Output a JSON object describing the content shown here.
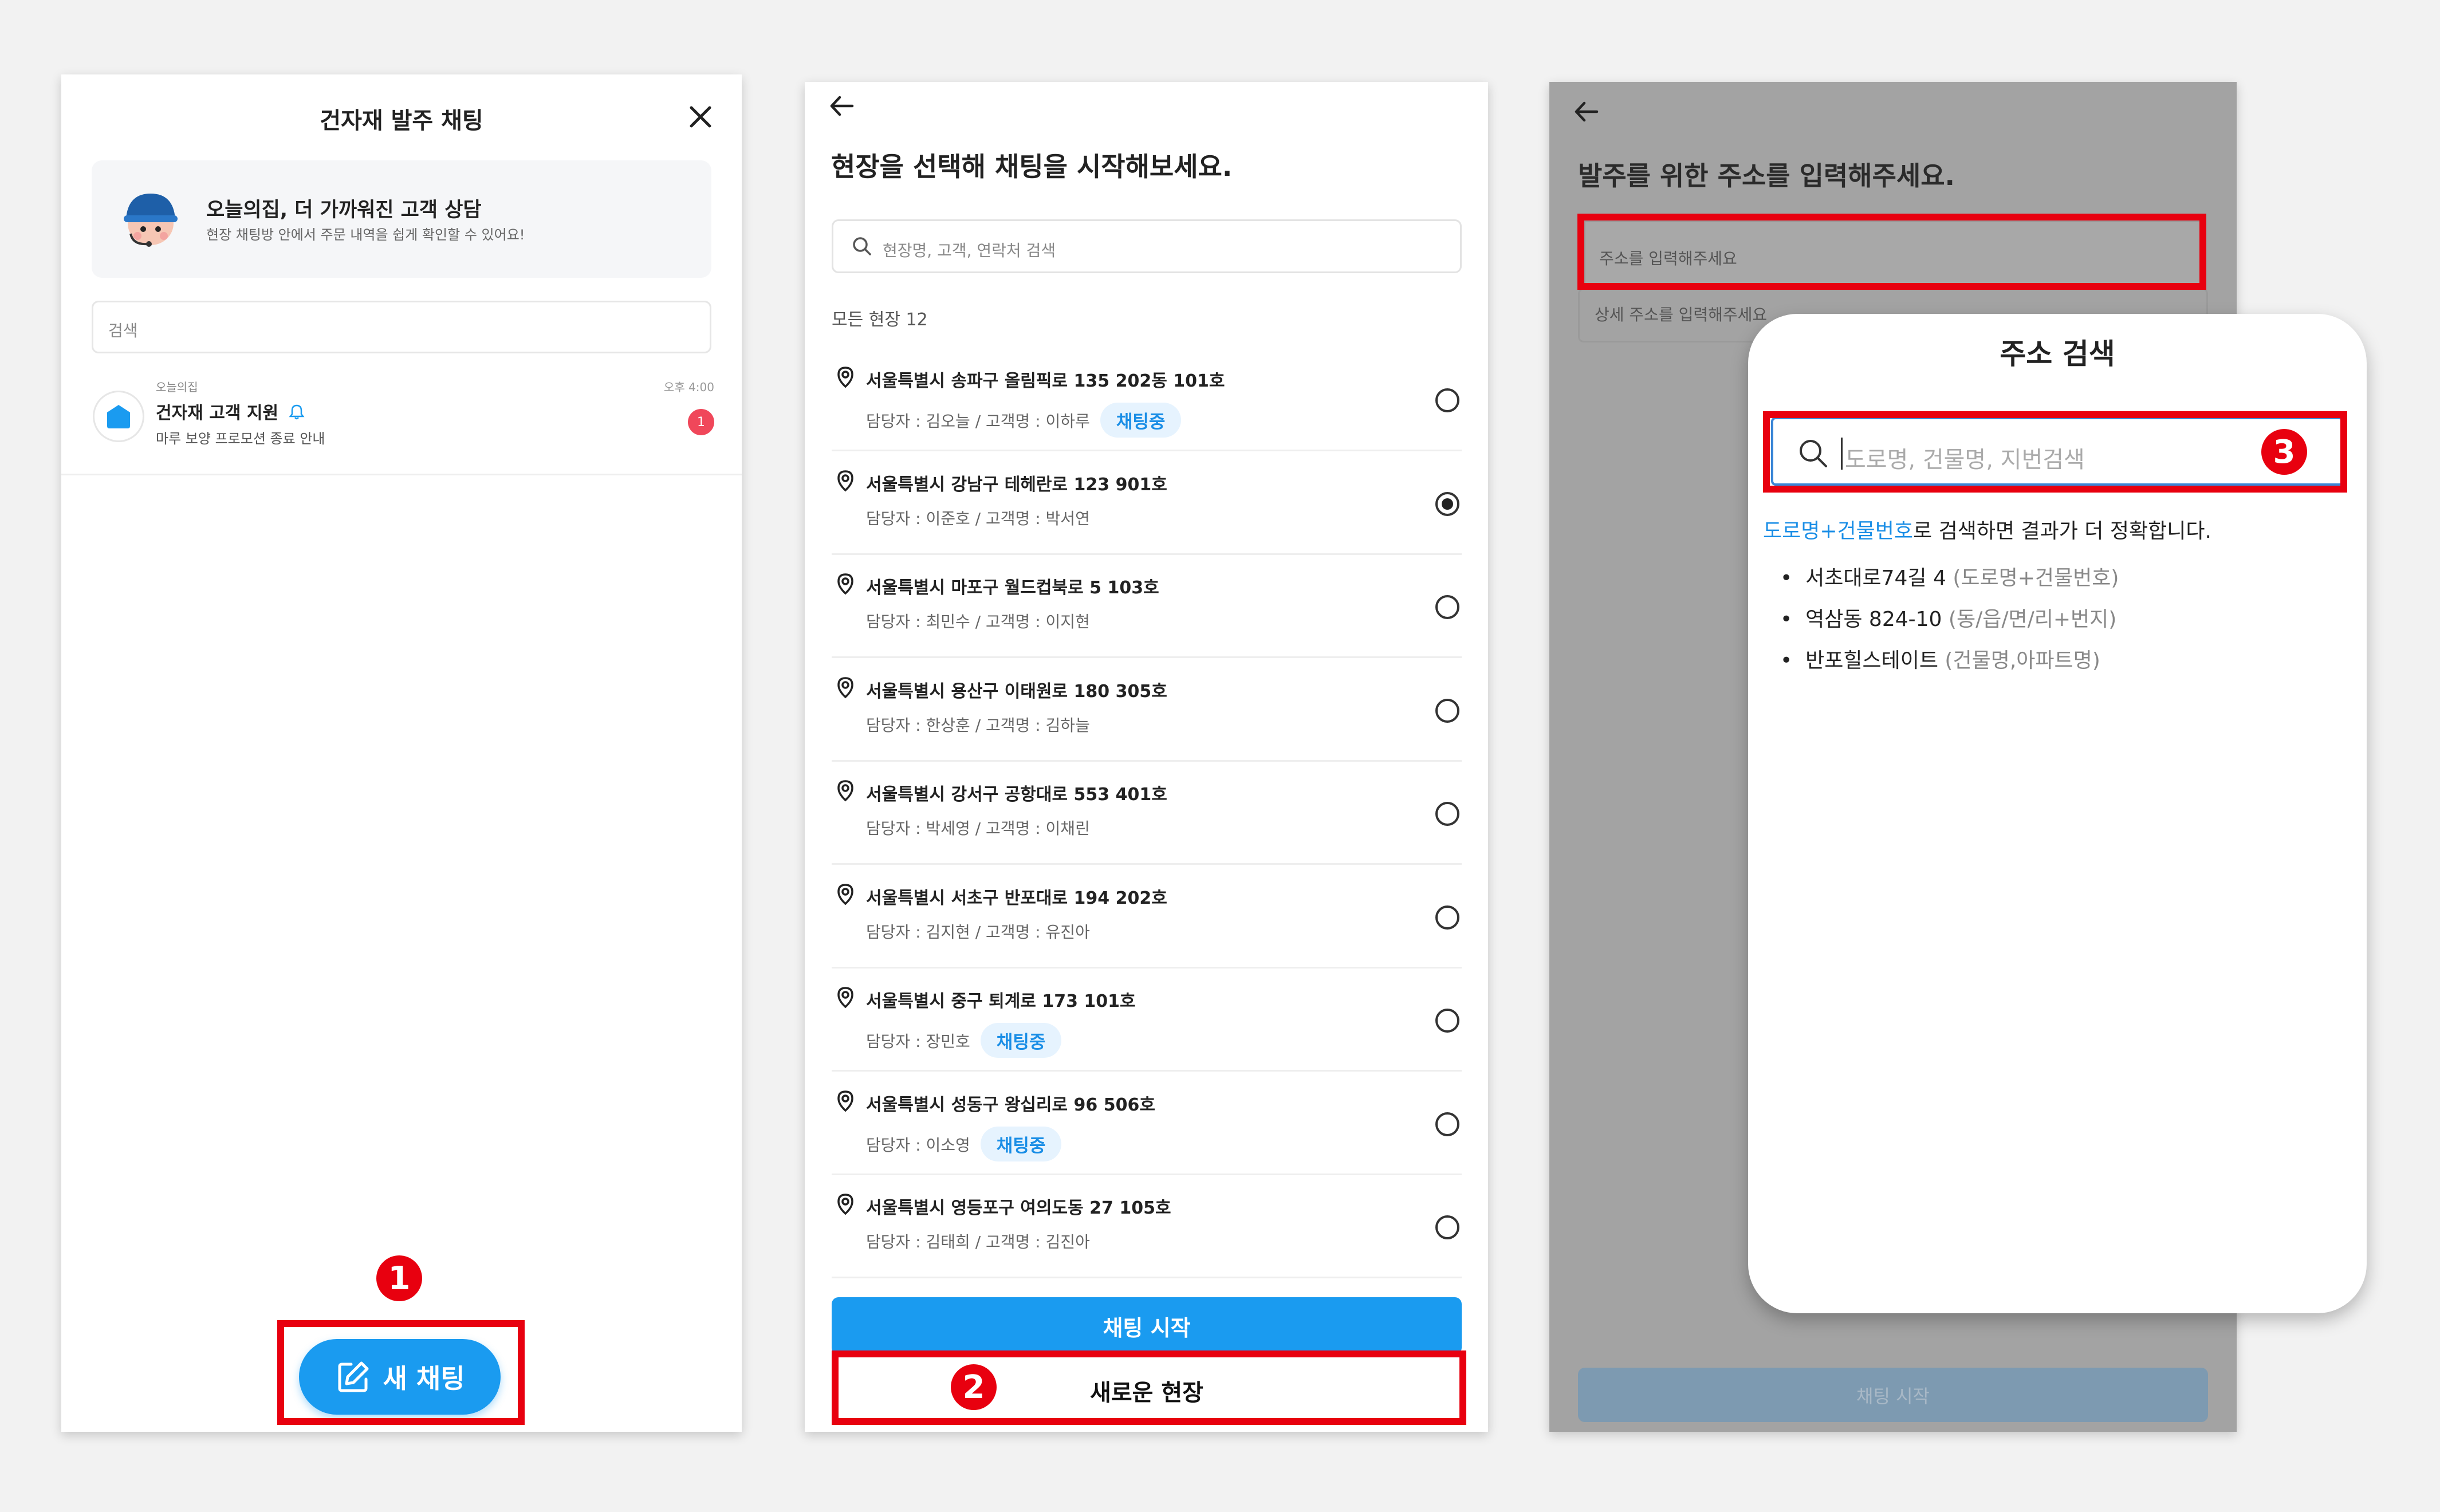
{
  "panel1": {
    "title": "건자재 발주 채팅",
    "promo": {
      "title": "오늘의집, 더 가까워진 고객 상담",
      "subtitle": "현장 채팅방 안에서 주문 내역을 쉽게 확인할 수 있어요!"
    },
    "search_placeholder": "검색",
    "chat": {
      "sender": "오늘의집",
      "name": "건자재 고객 지원",
      "preview": "마루 보양 프로모션 종료 안내",
      "time": "오후 4:00",
      "unread": "1"
    },
    "new_chat_label": "새 채팅"
  },
  "panel2": {
    "title": "현장을 선택해 채팅을 시작해보세요.",
    "search_placeholder": "현장명, 고객, 연락처 검색",
    "count_label": "모든 현장 12",
    "sites": [
      {
        "address": "서울특별시 송파구 올림픽로 135 202동 101호",
        "meta": "담당자 : 김오늘 / 고객명 : 이하루",
        "tag": "채팅중",
        "selected": false
      },
      {
        "address": "서울특별시 강남구 테헤란로 123 901호",
        "meta": "담당자 : 이준호 / 고객명 : 박서연",
        "tag": "",
        "selected": true
      },
      {
        "address": "서울특별시 마포구 월드컵북로 5 103호",
        "meta": "담당자 : 최민수 / 고객명 : 이지현",
        "tag": "",
        "selected": false
      },
      {
        "address": "서울특별시 용산구 이태원로 180 305호",
        "meta": "담당자 : 한상훈 / 고객명 : 김하늘",
        "tag": "",
        "selected": false
      },
      {
        "address": "서울특별시 강서구 공항대로 553 401호",
        "meta": "담당자 : 박세영 / 고객명 : 이채린",
        "tag": "",
        "selected": false
      },
      {
        "address": "서울특별시 서초구 반포대로 194 202호",
        "meta": "담당자 : 김지현 / 고객명 : 유진아",
        "tag": "",
        "selected": false
      },
      {
        "address": "서울특별시 중구 퇴계로 173 101호",
        "meta": "담당자 : 장민호",
        "tag": "채팅중",
        "selected": false
      },
      {
        "address": "서울특별시 성동구 왕십리로 96 506호",
        "meta": "담당자 : 이소영",
        "tag": "채팅중",
        "selected": false
      },
      {
        "address": "서울특별시 영등포구 여의도동 27 105호",
        "meta": "담당자 : 김태희  / 고객명 : 김진아",
        "tag": "",
        "selected": false
      }
    ],
    "start_label": "채팅 시작",
    "new_site_label": "새로운 현장"
  },
  "panel3": {
    "title": "발주를 위한 주소를 입력해주세요.",
    "address_placeholder": "주소를 입력해주세요",
    "detail_placeholder": "상세 주소를 입력해주세요",
    "start_label": "채팅 시작",
    "modal": {
      "title": "주소 검색",
      "search_placeholder": "도로명, 건물명, 지번검색",
      "hint_highlight": "도로명+건물번호",
      "hint_rest": "로 검색하면 결과가 더 정확합니다.",
      "examples": [
        {
          "main": "서초대로74길 4",
          "note": "(도로명+건물번호)"
        },
        {
          "main": "역삼동 824-10",
          "note": "(동/읍/면/리+번지)"
        },
        {
          "main": "반포힐스테이트",
          "note": "(건물명,아파트명)"
        }
      ]
    }
  },
  "annotations": {
    "step1": "1",
    "step2": "2",
    "step3": "3"
  },
  "colors": {
    "accent": "#1a9bf0",
    "annotation_red": "#e8000f",
    "dim_overlay": "#a3a3a3"
  }
}
